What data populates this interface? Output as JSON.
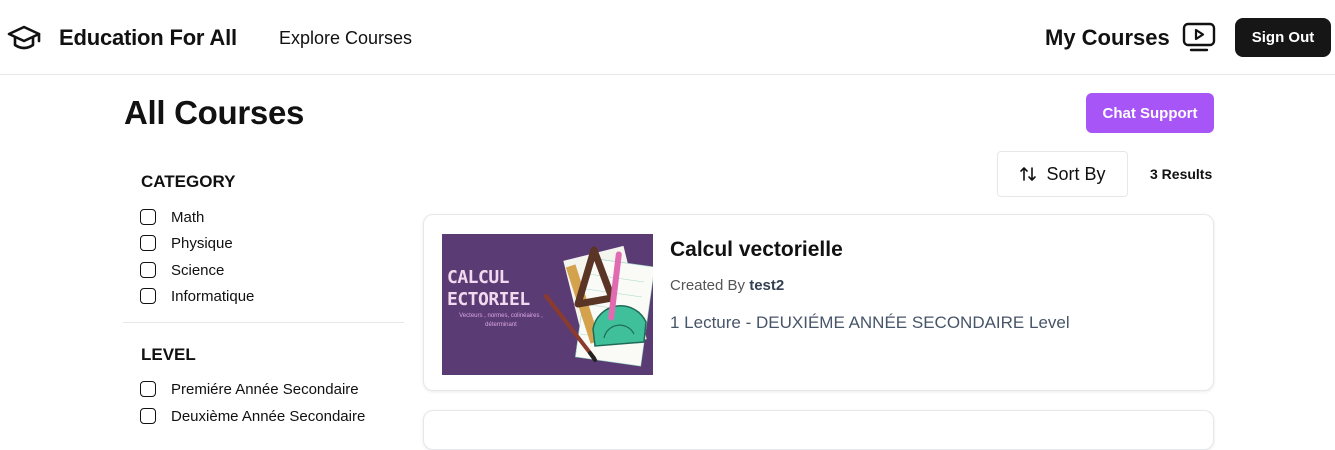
{
  "header": {
    "brand": "Education For All",
    "explore_link": "Explore Courses",
    "my_courses_link": "My Courses",
    "sign_out_label": "Sign Out"
  },
  "main": {
    "title": "All Courses",
    "chat_support_label": "Chat Support",
    "sort_label": "Sort By",
    "results_text": "3 Results"
  },
  "filters": {
    "category": {
      "heading": "CATEGORY",
      "options": [
        "Math",
        "Physique",
        "Science",
        "Informatique"
      ]
    },
    "level": {
      "heading": "LEVEL",
      "options": [
        "Premiére Année Secondaire",
        "Deuxième Année Secondaire"
      ]
    }
  },
  "courses": [
    {
      "title": "Calcul vectorielle",
      "created_by_prefix": "Created By",
      "author": "test2",
      "meta": "1 Lecture - DEUXIÉME ANNÉE SECONDAIRE Level",
      "thumbnail_title": "CALCUL\nECTORIEL",
      "thumbnail_subtitle": "Vecteurs , normes, colinéaires , déterminant"
    }
  ],
  "colors": {
    "accent": "#a855f7",
    "sign_out_bg": "#161616",
    "thumbnail_bg": "#5b3b73"
  },
  "icons": {
    "brand": "graduation-cap-icon",
    "my_courses": "play-screen-icon",
    "sort": "arrows-up-down-icon"
  }
}
